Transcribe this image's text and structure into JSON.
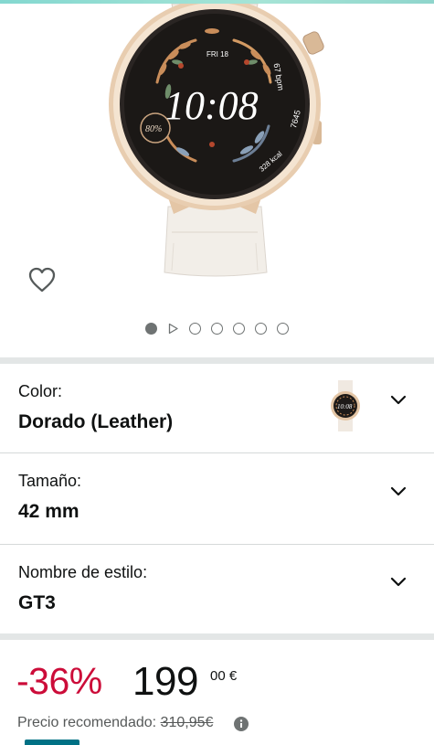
{
  "product": {
    "image_name": "smartwatch-gold-leather",
    "watch_face": {
      "time": "10:08",
      "date": "FRI 18",
      "battery": "80%",
      "calories": "328 kcal",
      "steps": "7645",
      "heart_rate": "67 bpm"
    },
    "gallery": {
      "active_index": 0,
      "total_dots": 7
    }
  },
  "variants": {
    "color": {
      "label": "Color:",
      "value": "Dorado (Leather)"
    },
    "size": {
      "label": "Tamaño:",
      "value": "42 mm"
    },
    "style": {
      "label": "Nombre de estilo:",
      "value": "GT3"
    }
  },
  "pricing": {
    "discount": "-36%",
    "price_whole": "199",
    "price_fraction": "00 €",
    "rrp_label": "Precio recomendado:",
    "rrp_value": "310,95€"
  },
  "colors": {
    "discount": "#cc0c39",
    "divider": "#e3e6e6",
    "accent": "#84d8d0"
  }
}
